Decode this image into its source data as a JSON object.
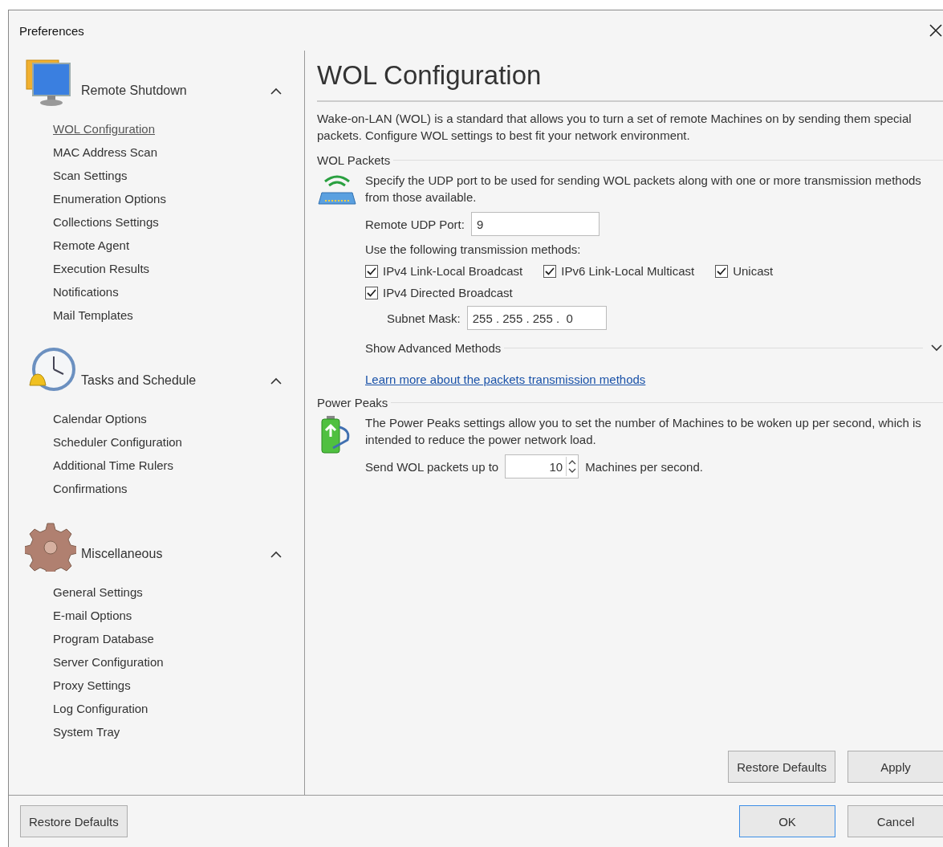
{
  "window": {
    "title": "Preferences"
  },
  "sidebar": {
    "groups": [
      {
        "kind": "monitor",
        "title": "Remote Shutdown",
        "expanded": true,
        "items": [
          {
            "label": "WOL Configuration",
            "selected": true
          },
          {
            "label": "MAC Address Scan",
            "selected": false
          },
          {
            "label": "Scan Settings",
            "selected": false
          },
          {
            "label": "Enumeration Options",
            "selected": false
          },
          {
            "label": "Collections Settings",
            "selected": false
          },
          {
            "label": "Remote Agent",
            "selected": false
          },
          {
            "label": "Execution Results",
            "selected": false
          },
          {
            "label": "Notifications",
            "selected": false
          },
          {
            "label": "Mail Templates",
            "selected": false
          }
        ]
      },
      {
        "kind": "clock",
        "title": "Tasks and Schedule",
        "expanded": true,
        "items": [
          {
            "label": "Calendar Options",
            "selected": false
          },
          {
            "label": "Scheduler Configuration",
            "selected": false
          },
          {
            "label": "Additional Time Rulers",
            "selected": false
          },
          {
            "label": "Confirmations",
            "selected": false
          }
        ]
      },
      {
        "kind": "gear",
        "title": "Miscellaneous",
        "expanded": true,
        "items": [
          {
            "label": "General Settings",
            "selected": false
          },
          {
            "label": "E-mail Options",
            "selected": false
          },
          {
            "label": "Program Database",
            "selected": false
          },
          {
            "label": "Server Configuration",
            "selected": false
          },
          {
            "label": "Proxy Settings",
            "selected": false
          },
          {
            "label": "Log Configuration",
            "selected": false
          },
          {
            "label": "System Tray",
            "selected": false
          }
        ]
      }
    ]
  },
  "page": {
    "title": "WOL Configuration",
    "description": "Wake-on-LAN (WOL) is a standard that allows you to turn a set of remote Machines on by sending them special packets. Configure WOL settings to best fit your network environment.",
    "wol_packets": {
      "heading": "WOL Packets",
      "text": "Specify the UDP port to be used for sending WOL packets along with one or more transmission methods from those available.",
      "port_label": "Remote UDP Port:",
      "port_value": "9",
      "methods_label": "Use the following transmission methods:",
      "method_rows": [
        [
          {
            "label": "IPv4 Link-Local Broadcast",
            "checked": true
          },
          {
            "label": "IPv6 Link-Local Multicast",
            "checked": true
          },
          {
            "label": "Unicast",
            "checked": true
          }
        ],
        [
          {
            "label": "IPv4 Directed Broadcast",
            "checked": true
          }
        ]
      ],
      "subnet_label": "Subnet Mask:",
      "subnet_value": "255 . 255 . 255 .  0",
      "advanced": {
        "label": "Show Advanced Methods",
        "expanded": false
      },
      "link": "Learn more about the packets transmission methods"
    },
    "power_peaks": {
      "heading": "Power Peaks",
      "text": "The Power Peaks settings allow you to set the number of Machines to be woken up per second, which is intended to reduce the power network load.",
      "prefix": "Send WOL packets up to",
      "value": "10",
      "suffix": "Machines per second."
    },
    "buttons": [
      "Restore Defaults",
      "Apply"
    ]
  },
  "footer": {
    "left_button": "Restore Defaults",
    "buttons": [
      {
        "label": "OK",
        "default": true
      },
      {
        "label": "Cancel",
        "default": false
      }
    ]
  }
}
